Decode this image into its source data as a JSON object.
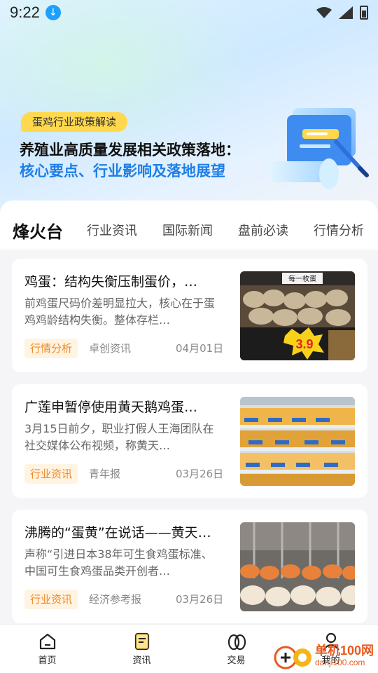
{
  "status_bar": {
    "time": "9:22"
  },
  "banner": {
    "tag": "蛋鸡行业政策解读",
    "headline": "养殖业高质量发展相关政策落地：",
    "subheadline": "核心要点、行业影响及落地展望"
  },
  "tabs": [
    {
      "label": "烽火台",
      "active": true
    },
    {
      "label": "行业资讯",
      "active": false
    },
    {
      "label": "国际新闻",
      "active": false
    },
    {
      "label": "盘前必读",
      "active": false
    },
    {
      "label": "行情分析",
      "active": false
    }
  ],
  "articles": [
    {
      "title": "鸡蛋：结构失衡压制蛋价，…",
      "summary": "前鸡蛋尺码价差明显拉大，核心在于蛋鸡鸡龄结构失衡。整体存栏…",
      "tag": "行情分析",
      "source": "卓创资讯",
      "date": "04月01日",
      "thumb_sign": "每一枚蛋",
      "thumb_price": "3.9"
    },
    {
      "title": "广莲申暂停使用黄天鹅鸡蛋…",
      "summary": "3月15日前夕，职业打假人王海团队在社交媒体公布视频，称黄天…",
      "tag": "行业资讯",
      "source": "青年报",
      "date": "03月26日"
    },
    {
      "title": "沸腾的“蛋黄”在说话——黄天…",
      "summary": "声称“引进日本38年可生食鸡蛋标准、中国可生食鸡蛋品类开创者…",
      "tag": "行业资讯",
      "source": "经济参考报",
      "date": "03月26日"
    }
  ],
  "bottom_nav": [
    {
      "label": "首页",
      "icon": "home-icon"
    },
    {
      "label": "资讯",
      "icon": "news-icon",
      "active": true
    },
    {
      "label": "交易",
      "icon": "egg-icon"
    },
    {
      "label": "我的",
      "icon": "user-icon"
    }
  ],
  "watermark": {
    "brand": "单机100网",
    "url": "danji100.com"
  },
  "colors": {
    "accent_yellow": "#ffcc33",
    "tag_orange": "#f08a24",
    "link_blue": "#1f7fe6"
  }
}
